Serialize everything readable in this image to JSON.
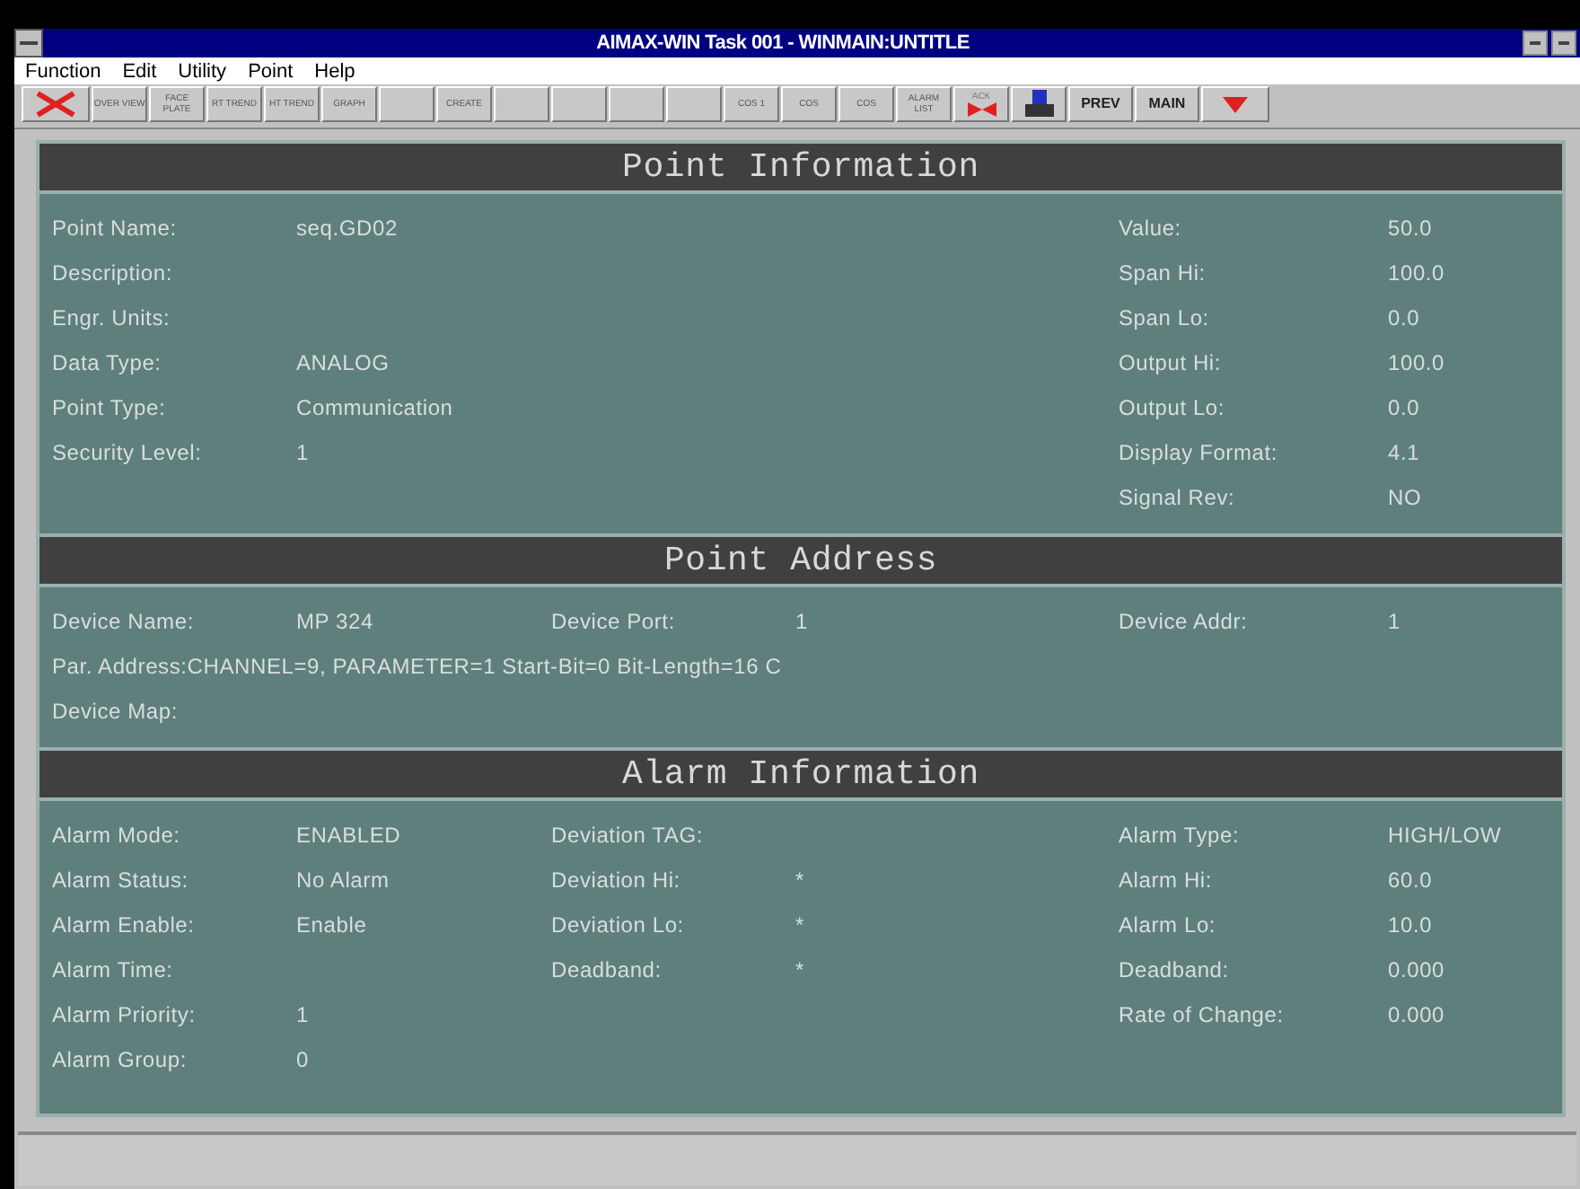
{
  "window": {
    "title": "AIMAX-WIN Task 001 - WINMAIN:UNTITLE"
  },
  "menu": [
    "Function",
    "Edit",
    "Utility",
    "Point",
    "Help"
  ],
  "toolbar": [
    {
      "kind": "close-x"
    },
    {
      "kind": "text",
      "label": "OVER VIEW"
    },
    {
      "kind": "text",
      "label": "FACE PLATE"
    },
    {
      "kind": "text",
      "label": "RT TREND"
    },
    {
      "kind": "text",
      "label": "HT TREND"
    },
    {
      "kind": "text",
      "label": "GRAPH"
    },
    {
      "kind": "blank"
    },
    {
      "kind": "text",
      "label": "CREATE"
    },
    {
      "kind": "blank"
    },
    {
      "kind": "blank"
    },
    {
      "kind": "blank"
    },
    {
      "kind": "blank"
    },
    {
      "kind": "text",
      "label": "COS 1"
    },
    {
      "kind": "text",
      "label": "COS"
    },
    {
      "kind": "text",
      "label": "COS"
    },
    {
      "kind": "text",
      "label": "ALARM LIST"
    },
    {
      "kind": "ack",
      "label": "ACK"
    },
    {
      "kind": "printer"
    },
    {
      "kind": "big",
      "label": "PREV"
    },
    {
      "kind": "big",
      "label": "MAIN"
    },
    {
      "kind": "down"
    }
  ],
  "sections": [
    {
      "title": "Point Information",
      "columns": [
        [
          {
            "label": "Point Name:",
            "value": "seq.GD02"
          },
          {
            "label": "Description:"
          },
          {
            "label": "Engr. Units:"
          },
          {
            "label": "Data Type:",
            "value": "ANALOG"
          },
          {
            "label": "Point Type:",
            "value": "Communication"
          },
          {
            "label": "Security Level:",
            "value": "1"
          }
        ],
        [],
        [
          {
            "label": "Value:",
            "value": "50.0"
          },
          {
            "label": "Span Hi:",
            "value": "100.0"
          },
          {
            "label": "Span Lo:",
            "value": "0.0"
          },
          {
            "label": "Output Hi:",
            "value": "100.0"
          },
          {
            "label": "Output Lo:",
            "value": "0.0"
          },
          {
            "label": "Display Format:",
            "value": "4.1"
          },
          {
            "label": "Signal Rev:",
            "value": "NO"
          }
        ]
      ]
    },
    {
      "title": "Point Address",
      "columns": [
        [
          {
            "label": "Device Name:",
            "value": "MP 324"
          },
          {
            "label": "Par. Address:",
            "value": "CHANNEL=9, PARAMETER=1 Start-Bit=0 Bit-Length=16 C"
          },
          {
            "label": "Device Map:"
          }
        ],
        [
          {
            "label": "Device Port:",
            "value": "1"
          }
        ],
        [
          {
            "label": "Device Addr:",
            "value": "1"
          }
        ]
      ]
    },
    {
      "title": "Alarm Information",
      "columns": [
        [
          {
            "label": "Alarm Mode:",
            "value": "ENABLED"
          },
          {
            "label": "Alarm Status:",
            "value": "No Alarm"
          },
          {
            "label": "Alarm Enable:",
            "value": "Enable"
          },
          {
            "label": "Alarm Time:"
          },
          {
            "label": "Alarm Priority:",
            "value": "1"
          },
          {
            "label": "Alarm Group:",
            "value": "0"
          }
        ],
        [
          {
            "label": "Deviation TAG:"
          },
          {
            "label": "Deviation Hi:",
            "value": "*"
          },
          {
            "label": "Deviation Lo:",
            "value": "*"
          },
          {
            "label": "Deadband:",
            "value": "*"
          }
        ],
        [
          {
            "label": "Alarm Type:",
            "value": "HIGH/LOW"
          },
          {
            "label": "Alarm Hi:",
            "value": "60.0"
          },
          {
            "label": "Alarm Lo:",
            "value": "10.0"
          },
          {
            "label": "Deadband:",
            "value": "0.000"
          },
          {
            "label": "Rate of Change:",
            "value": "0.000"
          }
        ]
      ]
    }
  ]
}
